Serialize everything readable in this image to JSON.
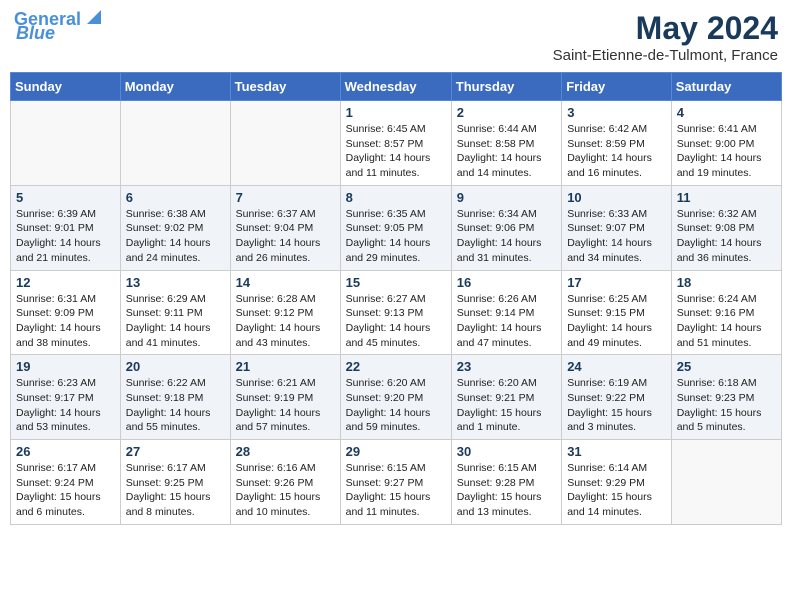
{
  "header": {
    "logo_line1": "General",
    "logo_line2": "Blue",
    "title": "May 2024",
    "subtitle": "Saint-Etienne-de-Tulmont, France"
  },
  "days_of_week": [
    "Sunday",
    "Monday",
    "Tuesday",
    "Wednesday",
    "Thursday",
    "Friday",
    "Saturday"
  ],
  "weeks": [
    [
      {
        "day": "",
        "info": ""
      },
      {
        "day": "",
        "info": ""
      },
      {
        "day": "",
        "info": ""
      },
      {
        "day": "1",
        "info": "Sunrise: 6:45 AM\nSunset: 8:57 PM\nDaylight: 14 hours\nand 11 minutes."
      },
      {
        "day": "2",
        "info": "Sunrise: 6:44 AM\nSunset: 8:58 PM\nDaylight: 14 hours\nand 14 minutes."
      },
      {
        "day": "3",
        "info": "Sunrise: 6:42 AM\nSunset: 8:59 PM\nDaylight: 14 hours\nand 16 minutes."
      },
      {
        "day": "4",
        "info": "Sunrise: 6:41 AM\nSunset: 9:00 PM\nDaylight: 14 hours\nand 19 minutes."
      }
    ],
    [
      {
        "day": "5",
        "info": "Sunrise: 6:39 AM\nSunset: 9:01 PM\nDaylight: 14 hours\nand 21 minutes."
      },
      {
        "day": "6",
        "info": "Sunrise: 6:38 AM\nSunset: 9:02 PM\nDaylight: 14 hours\nand 24 minutes."
      },
      {
        "day": "7",
        "info": "Sunrise: 6:37 AM\nSunset: 9:04 PM\nDaylight: 14 hours\nand 26 minutes."
      },
      {
        "day": "8",
        "info": "Sunrise: 6:35 AM\nSunset: 9:05 PM\nDaylight: 14 hours\nand 29 minutes."
      },
      {
        "day": "9",
        "info": "Sunrise: 6:34 AM\nSunset: 9:06 PM\nDaylight: 14 hours\nand 31 minutes."
      },
      {
        "day": "10",
        "info": "Sunrise: 6:33 AM\nSunset: 9:07 PM\nDaylight: 14 hours\nand 34 minutes."
      },
      {
        "day": "11",
        "info": "Sunrise: 6:32 AM\nSunset: 9:08 PM\nDaylight: 14 hours\nand 36 minutes."
      }
    ],
    [
      {
        "day": "12",
        "info": "Sunrise: 6:31 AM\nSunset: 9:09 PM\nDaylight: 14 hours\nand 38 minutes."
      },
      {
        "day": "13",
        "info": "Sunrise: 6:29 AM\nSunset: 9:11 PM\nDaylight: 14 hours\nand 41 minutes."
      },
      {
        "day": "14",
        "info": "Sunrise: 6:28 AM\nSunset: 9:12 PM\nDaylight: 14 hours\nand 43 minutes."
      },
      {
        "day": "15",
        "info": "Sunrise: 6:27 AM\nSunset: 9:13 PM\nDaylight: 14 hours\nand 45 minutes."
      },
      {
        "day": "16",
        "info": "Sunrise: 6:26 AM\nSunset: 9:14 PM\nDaylight: 14 hours\nand 47 minutes."
      },
      {
        "day": "17",
        "info": "Sunrise: 6:25 AM\nSunset: 9:15 PM\nDaylight: 14 hours\nand 49 minutes."
      },
      {
        "day": "18",
        "info": "Sunrise: 6:24 AM\nSunset: 9:16 PM\nDaylight: 14 hours\nand 51 minutes."
      }
    ],
    [
      {
        "day": "19",
        "info": "Sunrise: 6:23 AM\nSunset: 9:17 PM\nDaylight: 14 hours\nand 53 minutes."
      },
      {
        "day": "20",
        "info": "Sunrise: 6:22 AM\nSunset: 9:18 PM\nDaylight: 14 hours\nand 55 minutes."
      },
      {
        "day": "21",
        "info": "Sunrise: 6:21 AM\nSunset: 9:19 PM\nDaylight: 14 hours\nand 57 minutes."
      },
      {
        "day": "22",
        "info": "Sunrise: 6:20 AM\nSunset: 9:20 PM\nDaylight: 14 hours\nand 59 minutes."
      },
      {
        "day": "23",
        "info": "Sunrise: 6:20 AM\nSunset: 9:21 PM\nDaylight: 15 hours\nand 1 minute."
      },
      {
        "day": "24",
        "info": "Sunrise: 6:19 AM\nSunset: 9:22 PM\nDaylight: 15 hours\nand 3 minutes."
      },
      {
        "day": "25",
        "info": "Sunrise: 6:18 AM\nSunset: 9:23 PM\nDaylight: 15 hours\nand 5 minutes."
      }
    ],
    [
      {
        "day": "26",
        "info": "Sunrise: 6:17 AM\nSunset: 9:24 PM\nDaylight: 15 hours\nand 6 minutes."
      },
      {
        "day": "27",
        "info": "Sunrise: 6:17 AM\nSunset: 9:25 PM\nDaylight: 15 hours\nand 8 minutes."
      },
      {
        "day": "28",
        "info": "Sunrise: 6:16 AM\nSunset: 9:26 PM\nDaylight: 15 hours\nand 10 minutes."
      },
      {
        "day": "29",
        "info": "Sunrise: 6:15 AM\nSunset: 9:27 PM\nDaylight: 15 hours\nand 11 minutes."
      },
      {
        "day": "30",
        "info": "Sunrise: 6:15 AM\nSunset: 9:28 PM\nDaylight: 15 hours\nand 13 minutes."
      },
      {
        "day": "31",
        "info": "Sunrise: 6:14 AM\nSunset: 9:29 PM\nDaylight: 15 hours\nand 14 minutes."
      },
      {
        "day": "",
        "info": ""
      }
    ]
  ]
}
